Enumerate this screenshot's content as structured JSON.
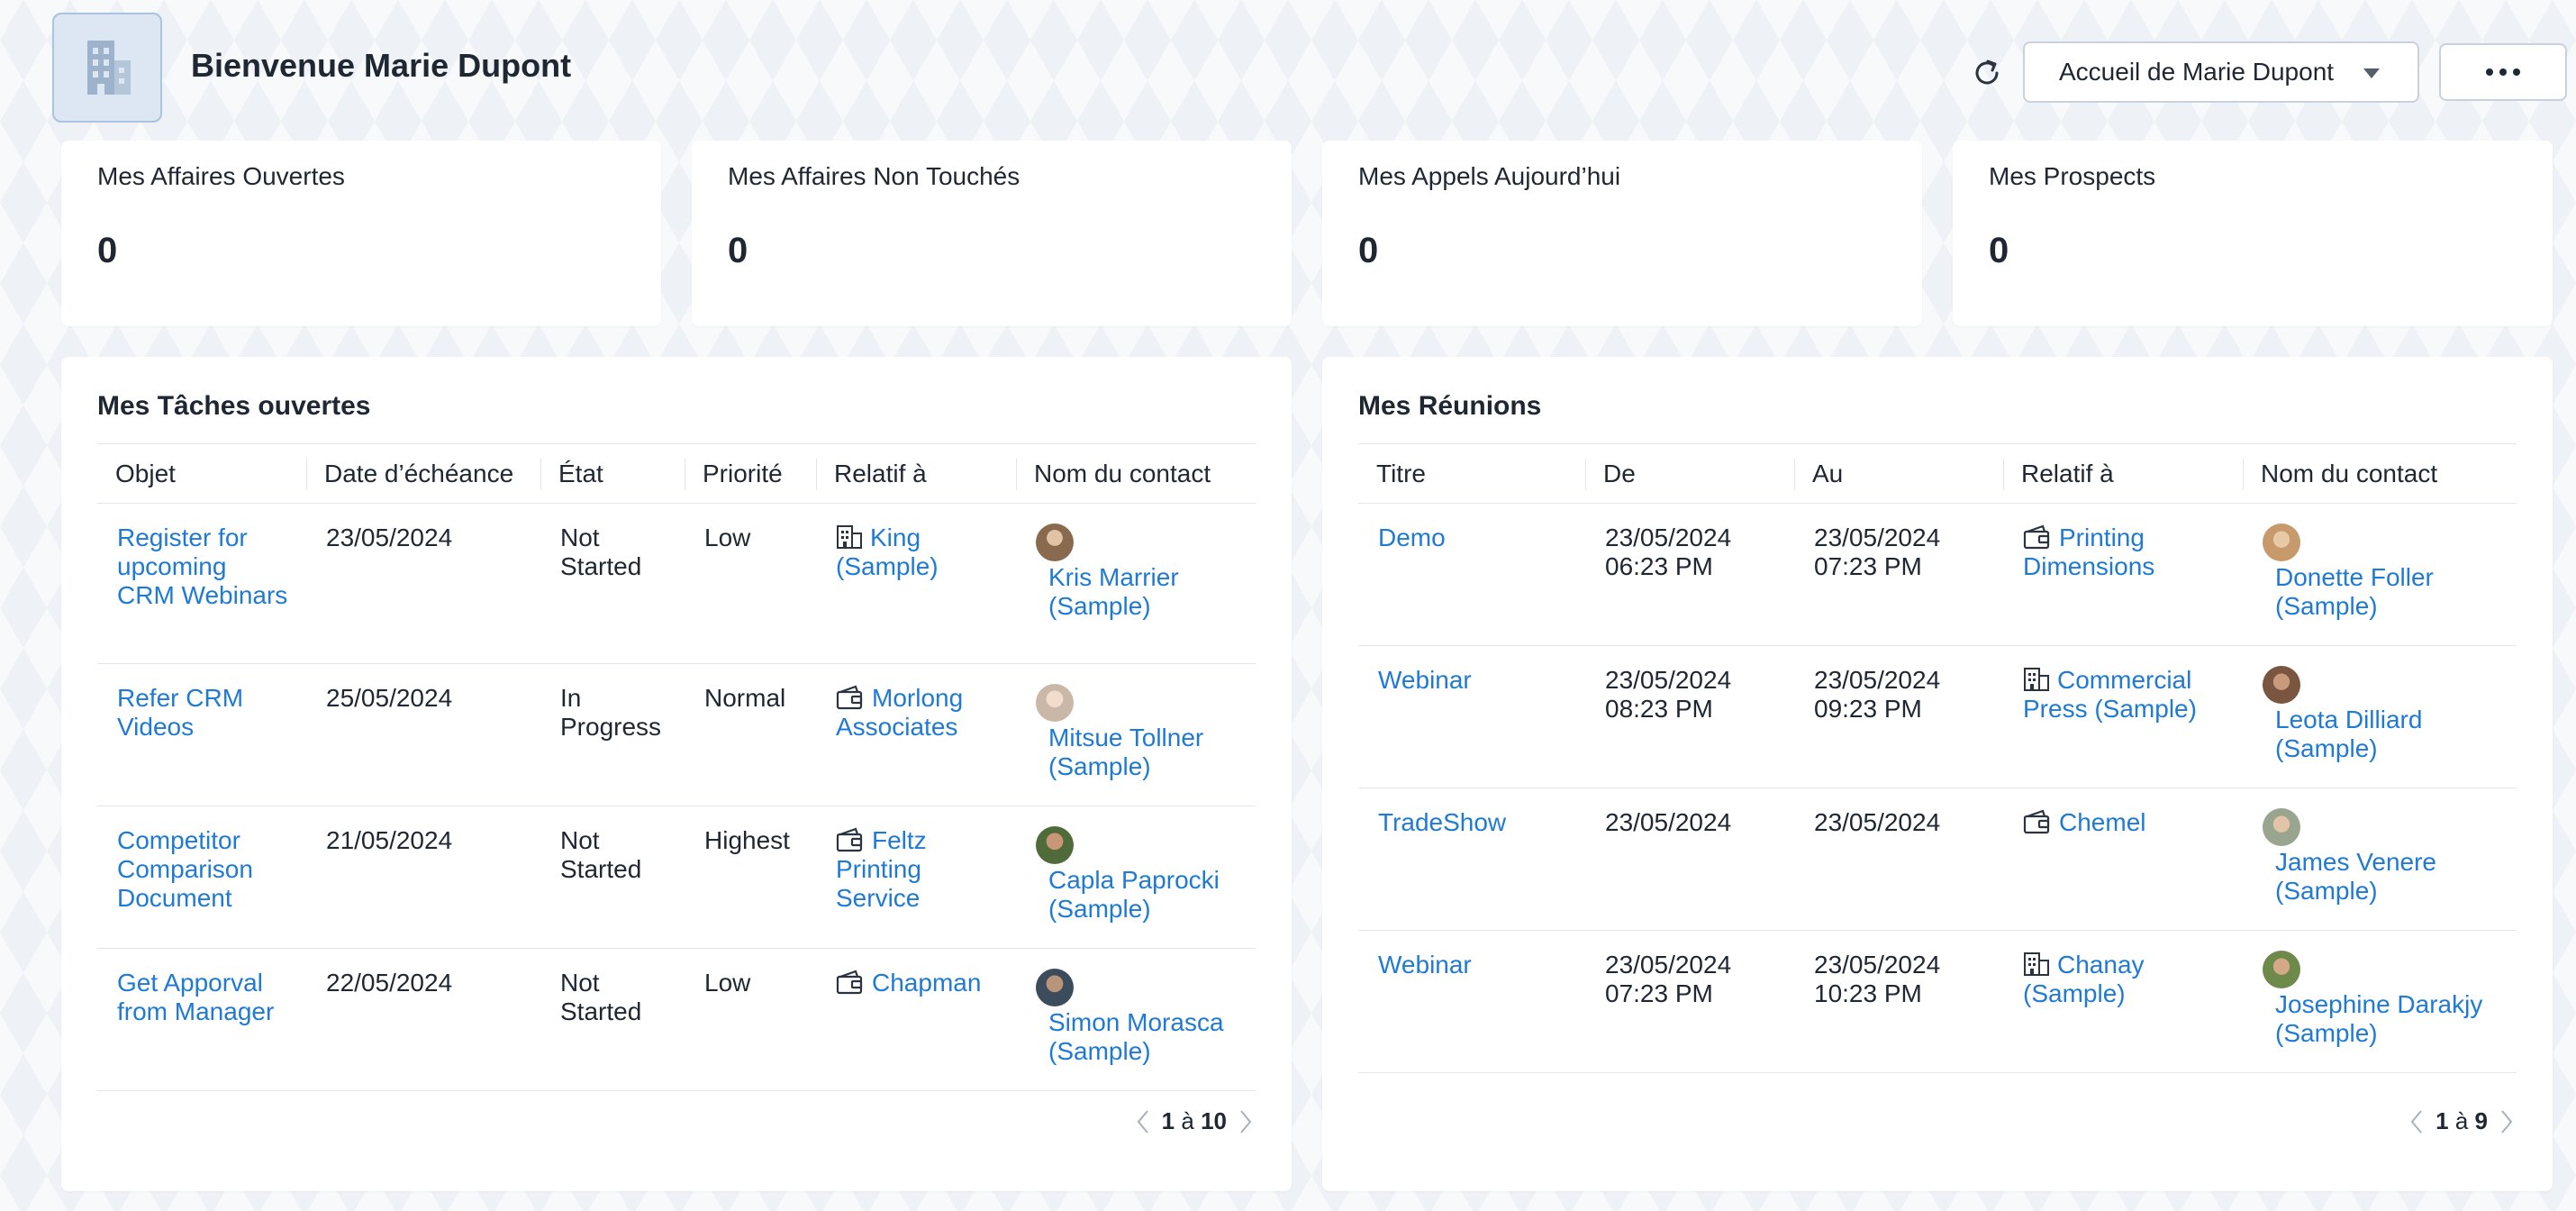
{
  "header": {
    "welcome": "Bienvenue Marie Dupont",
    "home_select": "Accueil de Marie Dupont"
  },
  "kpis": [
    {
      "title": "Mes Affaires Ouvertes",
      "value": "0"
    },
    {
      "title": "Mes Affaires Non Touchés",
      "value": "0"
    },
    {
      "title": "Mes Appels Aujourd’hui",
      "value": "0"
    },
    {
      "title": "Mes Prospects",
      "value": "0"
    }
  ],
  "tasks": {
    "title": "Mes Tâches ouvertes",
    "columns": [
      "Objet",
      "Date d’échéance",
      "État",
      "Priorité",
      "Relatif à",
      "Nom du contact"
    ],
    "rows": [
      {
        "objet": "Register for upcoming CRM Webinars",
        "date": "23/05/2024",
        "etat": "Not Started",
        "priorite": "Low",
        "relatif": "King (Sample)",
        "relatif_icon": "building-icon",
        "contact": "Kris Marrier (Sample)",
        "avatar_color": "#8a6a4f"
      },
      {
        "objet": "Refer CRM Videos",
        "date": "25/05/2024",
        "etat": "In Progress",
        "priorite": "Normal",
        "relatif": "Morlong Associates",
        "relatif_icon": "wallet-icon",
        "contact": "Mitsue Tollner (Sample)",
        "avatar_color": "#c9b8a8"
      },
      {
        "objet": "Competitor Comparison Document",
        "date": "21/05/2024",
        "etat": "Not Started",
        "priorite": "Highest",
        "relatif": "Feltz Printing Service",
        "relatif_icon": "wallet-icon",
        "contact": "Capla Paprocki (Sample)",
        "avatar_color": "#4f6b3a"
      },
      {
        "objet": "Get Apporval from Manager",
        "date": "22/05/2024",
        "etat": "Not Started",
        "priorite": "Low",
        "relatif": "Chapman",
        "relatif_icon": "wallet-icon",
        "contact": "Simon Morasca (Sample)",
        "avatar_color": "#3d4c5c"
      }
    ],
    "pager": {
      "from": "1",
      "sep": "à",
      "to": "10"
    }
  },
  "meetings": {
    "title": "Mes Réunions",
    "columns": [
      "Titre",
      "De",
      "Au",
      "Relatif à",
      "Nom du contact"
    ],
    "rows": [
      {
        "titre": "Demo",
        "de": "23/05/2024 06:23 PM",
        "au": "23/05/2024 07:23 PM",
        "relatif": "Printing Dimensions",
        "relatif_icon": "wallet-icon",
        "contact": "Donette Foller (Sample)",
        "avatar_color": "#c79a6c"
      },
      {
        "titre": "Webinar",
        "de": "23/05/2024 08:23 PM",
        "au": "23/05/2024 09:23 PM",
        "relatif": "Commercial Press (Sample)",
        "relatif_icon": "building-icon",
        "contact": "Leota Dilliard (Sample)",
        "avatar_color": "#7a5540"
      },
      {
        "titre": "TradeShow",
        "de": "23/05/2024",
        "au": "23/05/2024",
        "relatif": "Chemel",
        "relatif_icon": "wallet-icon",
        "contact": "James Venere (Sample)",
        "avatar_color": "#9aa58f"
      },
      {
        "titre": "Webinar",
        "de": "23/05/2024 07:23 PM",
        "au": "23/05/2024 10:23 PM",
        "relatif": "Chanay (Sample)",
        "relatif_icon": "building-icon",
        "contact": "Josephine Darakjy (Sample)",
        "avatar_color": "#6e8a4a"
      }
    ],
    "pager": {
      "from": "1",
      "sep": "à",
      "to": "9"
    }
  },
  "colors": {
    "link": "#1f7ad6",
    "text": "#1f2733",
    "border": "#e2e6ec"
  }
}
